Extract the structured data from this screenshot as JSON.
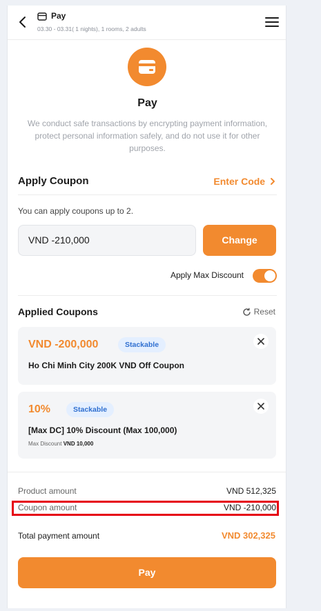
{
  "header": {
    "title": "Pay",
    "subtitle": "03.30 - 03.31( 1 nights), 1 rooms, 2 adults",
    "back_icon": "chevron-left-icon",
    "menu_icon": "hamburger-menu-icon"
  },
  "intro": {
    "title": "Pay",
    "description": "We conduct safe transactions by encrypting payment information, protect personal information safely, and do not use it for other purposes.",
    "icon": "credit-card-icon"
  },
  "apply_coupon": {
    "title": "Apply Coupon",
    "enter_code_label": "Enter Code",
    "note": "You can apply coupons up to 2.",
    "input_value": "VND  -210,000",
    "change_label": "Change",
    "max_discount_label": "Apply Max Discount",
    "max_discount_on": true
  },
  "applied_coupons": {
    "title": "Applied Coupons",
    "reset_label": "Reset",
    "items": [
      {
        "amount": "VND -200,000",
        "badge": "Stackable",
        "name": "Ho Chi Minh City 200K VND Off Coupon"
      },
      {
        "amount": "10%",
        "badge": "Stackable",
        "name": "[Max DC] 10% Discount (Max 100,000)",
        "extra_label": "Max Discount",
        "extra_value": "VND 10,000"
      }
    ]
  },
  "summary": {
    "product_label": "Product amount",
    "product_value": "VND 512,325",
    "coupon_label": "Coupon amount",
    "coupon_value": "VND -210,000",
    "total_label": "Total payment amount",
    "total_value": "VND 302,325"
  },
  "pay_button_label": "Pay",
  "colors": {
    "accent": "#f28a2f",
    "badge_bg": "#e4efff",
    "badge_text": "#2f6fd0",
    "highlight": "#e60012"
  }
}
